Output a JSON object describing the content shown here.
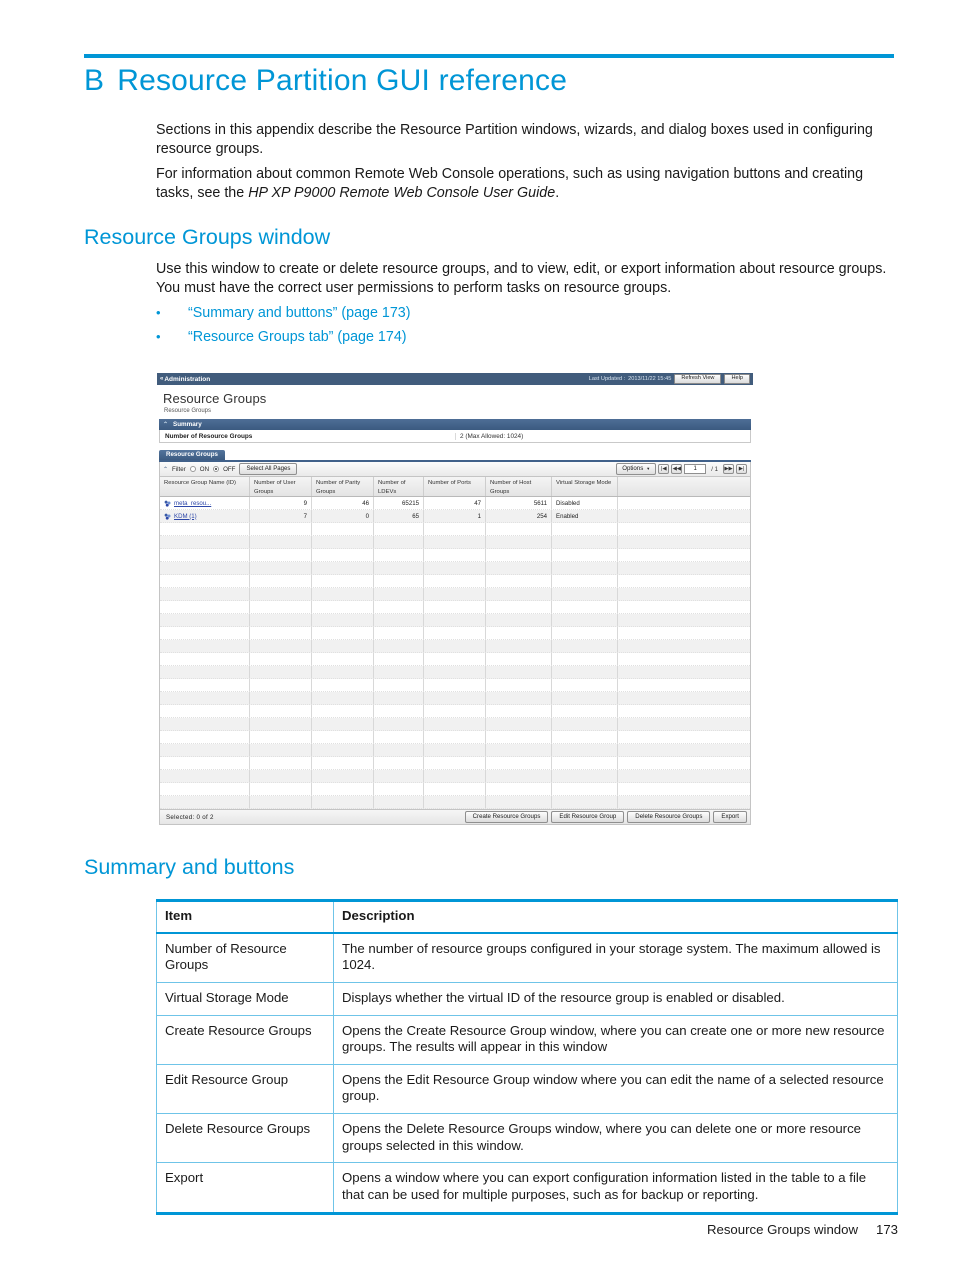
{
  "chapter": {
    "letter": "B",
    "title": "Resource Partition GUI reference"
  },
  "intro": {
    "para1": "Sections in this appendix describe the Resource Partition windows, wizards, and dialog boxes used in configuring resource groups.",
    "para2_pre": "For information about common Remote Web Console operations, such as using navigation buttons and creating tasks, see the ",
    "para2_italic": "HP XP P9000 Remote Web Console User Guide",
    "para2_post": "."
  },
  "section_resource_groups": {
    "heading": "Resource Groups window",
    "para": "Use this window to create or delete resource groups, and to view, edit, or export information about resource groups. You must have the correct user permissions to perform tasks on resource groups.",
    "bullets": [
      {
        "bullet": "•",
        "text": "“Summary and buttons” (page 173)"
      },
      {
        "bullet": "•",
        "text": "“Resource Groups tab” (page 174)"
      }
    ]
  },
  "app_screenshot": {
    "titlebar": {
      "chevron": "«",
      "breadcrumb_label": "Administration",
      "last_updated_label": "Last Updated :",
      "last_updated_value": "2013/11/22 15:45",
      "refresh_button": "Refresh View",
      "help_button": "Help"
    },
    "page_title": "Resource Groups",
    "breadcrumb": "Resource Groups",
    "summary": {
      "section_label": "Summary",
      "collapse_glyph": "⌃",
      "row_label": "Number of Resource Groups",
      "row_value": "2 (Max Allowed: 1024)"
    },
    "tab": {
      "label": "Resource Groups"
    },
    "toolbar": {
      "filter_glyph": "⌃",
      "filter_label": "Filter",
      "radio_on_label": "ON",
      "radio_off_label": "OFF",
      "radio_selected": "OFF",
      "select_all_pages": "Select All Pages",
      "options_label": "Options",
      "options_caret": "▼",
      "first_page_glyph": "|◀",
      "prev_page_glyph": "◀◀",
      "page_value": "1",
      "page_total": "/ 1",
      "next_page_glyph": "▶▶",
      "last_page_glyph": "▶|"
    },
    "grid": {
      "columns": [
        "Resource Group Name (ID)",
        "Number of User Groups",
        "Number of Parity Groups",
        "Number of LDEVs",
        "Number of Ports",
        "Number of Host Groups",
        "Virtual Storage Mode",
        ""
      ],
      "rows": [
        {
          "name": "meta_resou...",
          "user_groups": "9",
          "parity_groups": "46",
          "ldevs": "65215",
          "ports": "47",
          "host_groups": "5611",
          "virtual_storage_mode": "Disabled"
        },
        {
          "name": "KDM (1)",
          "user_groups": "7",
          "parity_groups": "0",
          "ldevs": "65",
          "ports": "1",
          "host_groups": "254",
          "virtual_storage_mode": "Enabled"
        }
      ],
      "empty_row_count": 22
    },
    "footer": {
      "selected_text": "Selected: 0  of  2",
      "buttons": [
        "Create Resource Groups",
        "Edit Resource Group",
        "Delete Resource Groups",
        "Export"
      ]
    }
  },
  "section_summary_buttons": {
    "heading": "Summary and buttons",
    "table": {
      "headers": [
        "Item",
        "Description"
      ],
      "rows": [
        {
          "item": "Number of Resource Groups",
          "description": "The number of resource groups configured in your storage system. The maximum allowed is 1024."
        },
        {
          "item": "Virtual Storage Mode",
          "description": "Displays whether the virtual ID of the resource group is enabled or disabled."
        },
        {
          "item": "Create Resource Groups",
          "description": "Opens the Create Resource Group window, where you can create one or more new resource groups. The results will appear in this window"
        },
        {
          "item": "Edit Resource Group",
          "description": "Opens the Edit Resource Group window where you can edit the name of a selected resource group."
        },
        {
          "item": "Delete Resource Groups",
          "description": "Opens the Delete Resource Groups window, where you can delete one or more resource groups selected in this window."
        },
        {
          "item": "Export",
          "description": "Opens a window where you can export configuration information listed in the table to a file that can be used for multiple purposes, such as for backup or reporting."
        }
      ]
    }
  },
  "page_footer": {
    "section_name": "Resource Groups window",
    "page_number": "173"
  },
  "colors": {
    "accent_blue": "#0096d6",
    "table_border_blue": "#6fc4e8",
    "app_header_navy": "#41618a",
    "link_blue": "#2c46a8"
  }
}
